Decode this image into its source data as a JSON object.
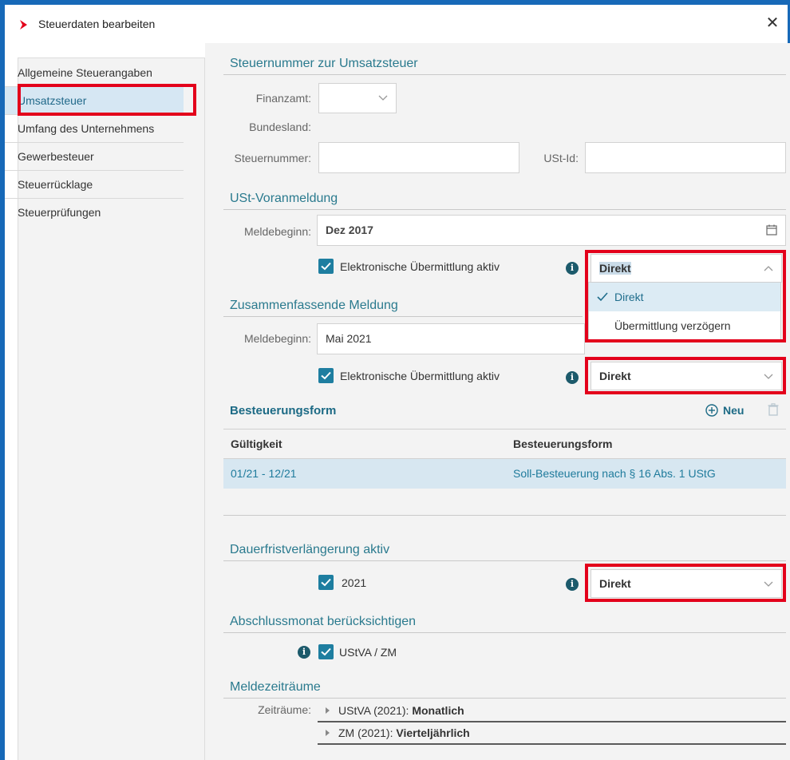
{
  "window": {
    "title": "Steuerdaten bearbeiten"
  },
  "sidebar": {
    "items": [
      {
        "label": "Allgemeine Steuerangaben",
        "active": false
      },
      {
        "label": "Umsatzsteuer",
        "active": true
      },
      {
        "label": "Umfang des Unternehmens",
        "active": false
      },
      {
        "label": "Gewerbesteuer",
        "active": false
      },
      {
        "label": "Steuerrücklage",
        "active": false
      },
      {
        "label": "Steuerprüfungen",
        "active": false
      }
    ]
  },
  "steuernummer_section": {
    "title": "Steuernummer zur Umsatzsteuer",
    "finanzamt_label": "Finanzamt:",
    "finanzamt_value": "",
    "bundesland_label": "Bundesland:",
    "steuernummer_label": "Steuernummer:",
    "steuernummer_value": "",
    "ustid_label": "USt-Id:",
    "ustid_value": ""
  },
  "ust_voranmeldung": {
    "title": "USt-Voranmeldung",
    "meldebeginn_label": "Meldebeginn:",
    "meldebeginn_value": "Dez 2017",
    "checkbox_label": "Elektronische Übermittlung aktiv",
    "checked": true,
    "select_value": "Direkt",
    "dropdown_options": [
      "Direkt",
      "Übermittlung verzögern"
    ],
    "selected_option": "Direkt"
  },
  "zusammenfassende_meldung": {
    "title": "Zusammenfassende Meldung",
    "meldebeginn_label": "Meldebeginn:",
    "meldebeginn_value": "Mai 2021",
    "checkbox_label": "Elektronische Übermittlung aktiv",
    "checked": true,
    "select_value": "Direkt"
  },
  "besteuerungsform": {
    "title": "Besteuerungsform",
    "new_label": "Neu",
    "columns": [
      "Gültigkeit",
      "Besteuerungsform"
    ],
    "rows": [
      {
        "gueltigkeit": "01/21 - 12/21",
        "form": "Soll-Besteuerung nach § 16 Abs. 1 UStG"
      }
    ]
  },
  "dauerfrist": {
    "title": "Dauerfristverlängerung aktiv",
    "checkbox_label": "2021",
    "checked": true,
    "select_value": "Direkt"
  },
  "abschlussmonat": {
    "title": "Abschlussmonat berücksichtigen",
    "checkbox_label": "UStVA / ZM",
    "checked": true
  },
  "meldezeitraeume": {
    "title": "Meldezeiträume",
    "label": "Zeiträume:",
    "items": [
      {
        "prefix": "UStVA (2021): ",
        "value": "Monatlich"
      },
      {
        "prefix": "ZM (2021): ",
        "value": "Vierteljährlich"
      }
    ]
  },
  "colors": {
    "accent": "#2a7a8e",
    "highlight": "#e3001b",
    "selection": "#d6e7f3",
    "window_border": "#1769b8"
  }
}
